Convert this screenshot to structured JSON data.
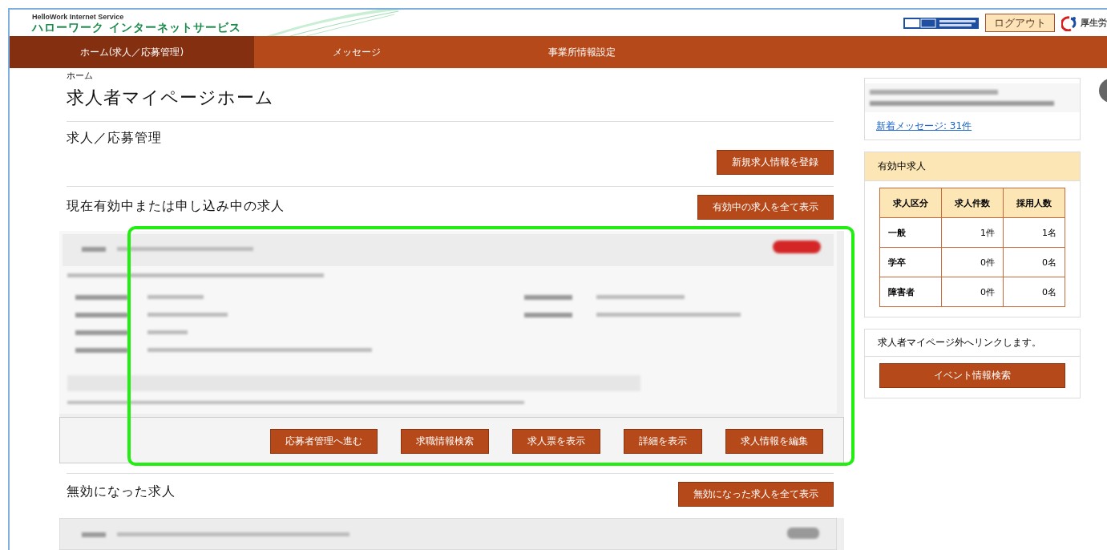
{
  "header": {
    "logo_en": "HelloWork Internet Service",
    "logo_jp": "ハローワーク インターネットサービス",
    "logout": "ログアウト",
    "ministry": "厚生労"
  },
  "nav": [
    {
      "label": "ホーム(求人／応募管理)",
      "selected": true
    },
    {
      "label": "メッセージ",
      "selected": false
    },
    {
      "label": "事業所情報設定",
      "selected": false
    }
  ],
  "breadcrumb": "ホーム",
  "page_title": "求人者マイページホーム",
  "sections": [
    {
      "heading": "求人／応募管理",
      "button": "新規求人情報を登録"
    },
    {
      "heading": "現在有効中または申し込み中の求人",
      "button": "有効中の求人を全て表示",
      "card": {
        "kind": "full",
        "actions": [
          "応募者管理へ進む",
          "求職情報検索",
          "求人票を表示",
          "詳細を表示",
          "求人情報を編集"
        ]
      }
    },
    {
      "heading": "無効になった求人",
      "button": "無効になった求人を全て表示",
      "card": {
        "kind": "collapsed"
      }
    }
  ],
  "sidebar": {
    "message_link": "新着メッセージ: 31件",
    "active_jobs": {
      "title": "有効中求人",
      "columns": [
        "求人区分",
        "求人件数",
        "採用人数"
      ],
      "rows": [
        [
          "一般",
          "1件",
          "1名"
        ],
        [
          "学卒",
          "0件",
          "0名"
        ],
        [
          "障害者",
          "0件",
          "0名"
        ]
      ]
    },
    "external": {
      "text": "求人者マイページ外へリンクします。",
      "button": "イベント情報検索"
    }
  }
}
